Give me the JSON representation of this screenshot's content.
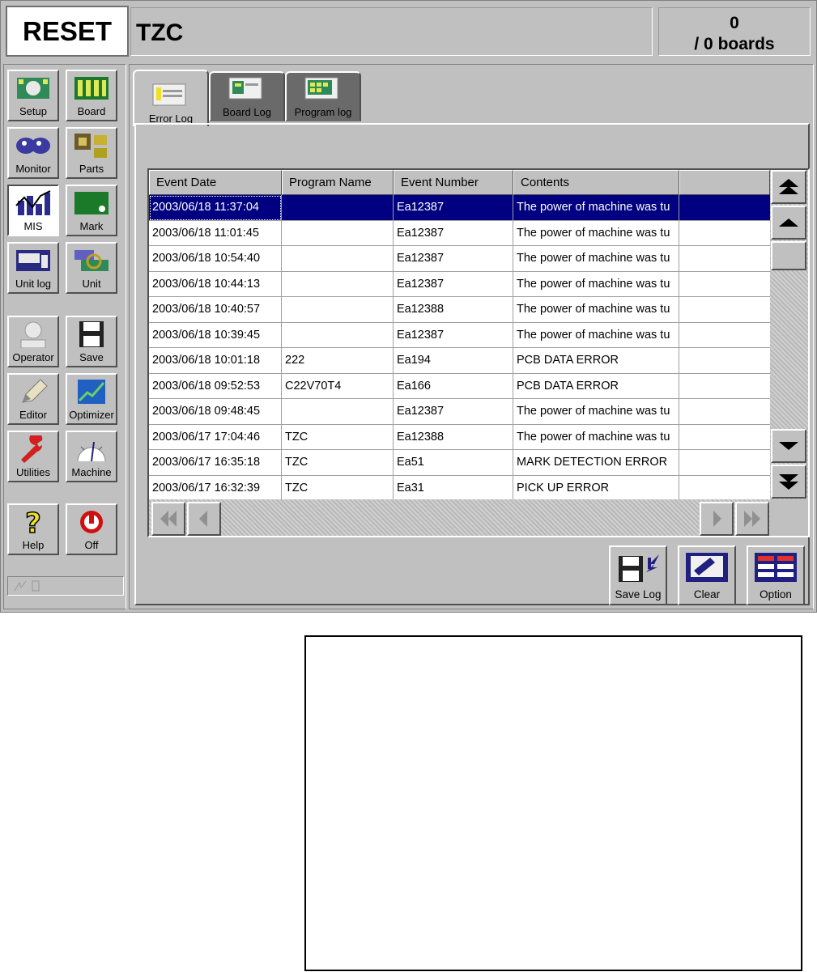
{
  "header": {
    "status": "RESET",
    "program": "TZC",
    "count": "0",
    "boards": "/ 0 boards"
  },
  "sidebar": {
    "buttons": [
      {
        "label": "Setup",
        "icon": "setup-icon"
      },
      {
        "label": "Board",
        "icon": "board-icon"
      },
      {
        "label": "Monitor",
        "icon": "monitor-icon"
      },
      {
        "label": "Parts",
        "icon": "parts-icon"
      },
      {
        "label": "MIS",
        "icon": "mis-chart-icon",
        "active": true
      },
      {
        "label": "Mark",
        "icon": "mark-icon"
      },
      {
        "label": "Unit log",
        "icon": "unit-log-icon"
      },
      {
        "label": "Unit",
        "icon": "unit-icon"
      },
      {
        "label": "Operator",
        "icon": "operator-icon"
      },
      {
        "label": "Save",
        "icon": "floppy-disk-icon"
      },
      {
        "label": "Editor",
        "icon": "pencil-icon"
      },
      {
        "label": "Optimizer",
        "icon": "optimizer-icon"
      },
      {
        "label": "Utilities",
        "icon": "wrench-icon"
      },
      {
        "label": "Machine",
        "icon": "gauge-icon"
      },
      {
        "label": "Help",
        "icon": "question-icon"
      },
      {
        "label": "Off",
        "icon": "power-icon"
      }
    ]
  },
  "tabs": [
    {
      "label": "Error Log",
      "active": true
    },
    {
      "label": "Board Log",
      "active": false
    },
    {
      "label": "Program log",
      "active": false
    }
  ],
  "table": {
    "columns": [
      "Event Date",
      "Program Name",
      "Event Number",
      "Contents"
    ],
    "rows": [
      {
        "date": "2003/06/18 11:37:04",
        "program": "",
        "event": "Ea12387",
        "contents": "The power of machine was tu",
        "selected": true
      },
      {
        "date": "2003/06/18 11:01:45",
        "program": "",
        "event": "Ea12387",
        "contents": "The power of machine was tu"
      },
      {
        "date": "2003/06/18 10:54:40",
        "program": "",
        "event": "Ea12387",
        "contents": "The power of machine was tu"
      },
      {
        "date": "2003/06/18 10:44:13",
        "program": "",
        "event": "Ea12387",
        "contents": "The power of machine was tu"
      },
      {
        "date": "2003/06/18 10:40:57",
        "program": "",
        "event": "Ea12388",
        "contents": "The power of machine was tu"
      },
      {
        "date": "2003/06/18 10:39:45",
        "program": "",
        "event": "Ea12387",
        "contents": "The power of machine was tu"
      },
      {
        "date": "2003/06/18 10:01:18",
        "program": "222",
        "event": "Ea194",
        "contents": "PCB DATA ERROR"
      },
      {
        "date": "2003/06/18 09:52:53",
        "program": "C22V70T4",
        "event": "Ea166",
        "contents": "PCB DATA ERROR"
      },
      {
        "date": "2003/06/18 09:48:45",
        "program": "",
        "event": "Ea12387",
        "contents": "The power of machine was tu"
      },
      {
        "date": "2003/06/17 17:04:46",
        "program": "TZC",
        "event": "Ea12388",
        "contents": "The power of machine was tu"
      },
      {
        "date": "2003/06/17 16:35:18",
        "program": "TZC",
        "event": "Ea51",
        "contents": "MARK DETECTION ERROR"
      },
      {
        "date": "2003/06/17 16:32:39",
        "program": "TZC",
        "event": "Ea31",
        "contents": "PICK UP ERROR"
      }
    ]
  },
  "actions": [
    {
      "label": "Save Log",
      "icon": "save-log-icon"
    },
    {
      "label": "Clear",
      "icon": "clear-icon"
    },
    {
      "label": "Option",
      "icon": "option-icon"
    }
  ]
}
